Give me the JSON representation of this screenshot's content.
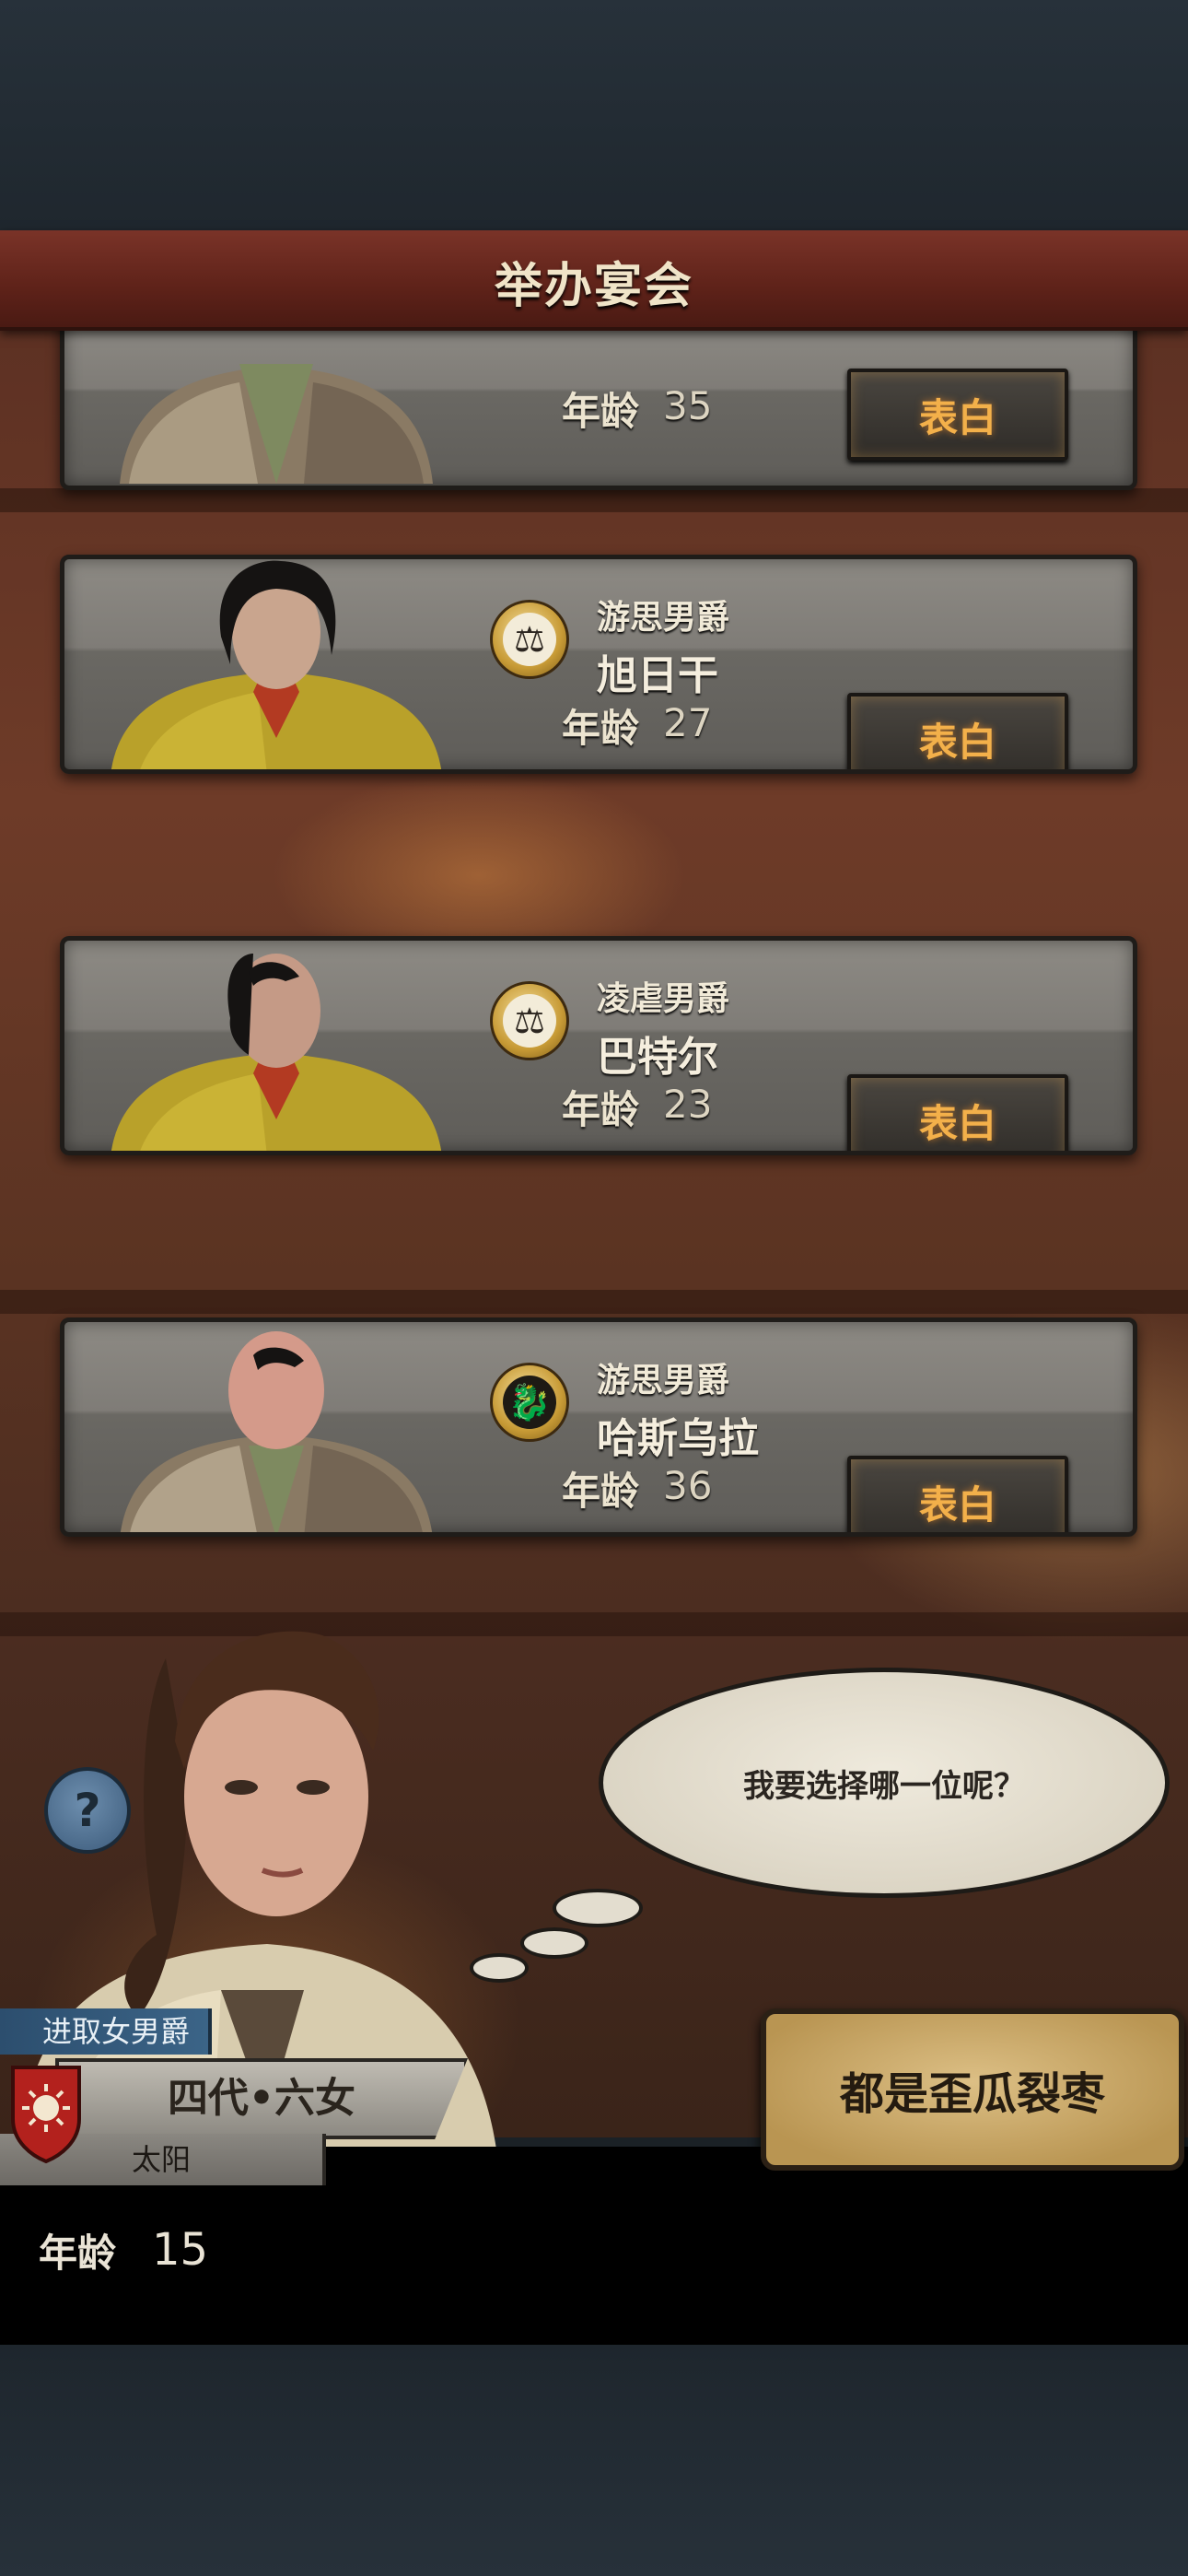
{
  "header": {
    "title": "举办宴会"
  },
  "suitors": [
    {
      "title": "",
      "name": "",
      "age_label": "年龄",
      "age": "35",
      "button": "表白",
      "emblem": "",
      "outfit": "fur"
    },
    {
      "title": "游思男爵",
      "name": "旭日干",
      "age_label": "年龄",
      "age": "27",
      "button": "表白",
      "emblem": "scales-icon",
      "outfit": "gold"
    },
    {
      "title": "凌虐男爵",
      "name": "巴特尔",
      "age_label": "年龄",
      "age": "23",
      "button": "表白",
      "emblem": "scales-icon",
      "outfit": "gold"
    },
    {
      "title": "游思男爵",
      "name": "哈斯乌拉",
      "age_label": "年龄",
      "age": "36",
      "button": "表白",
      "emblem": "dragon-icon",
      "outfit": "fur"
    }
  ],
  "speech": {
    "text": "我要选择哪一位呢？"
  },
  "help": {
    "label": "?"
  },
  "player": {
    "title": "进取女男爵",
    "name": "四代•六女",
    "house": "太阳",
    "age_label": "年龄",
    "age": "15"
  },
  "reject_button": {
    "label": "都是歪瓜裂枣"
  },
  "colors": {
    "accent": "#f3b04a",
    "title_bar": "#6e2a20",
    "card": "#7f7c77"
  }
}
